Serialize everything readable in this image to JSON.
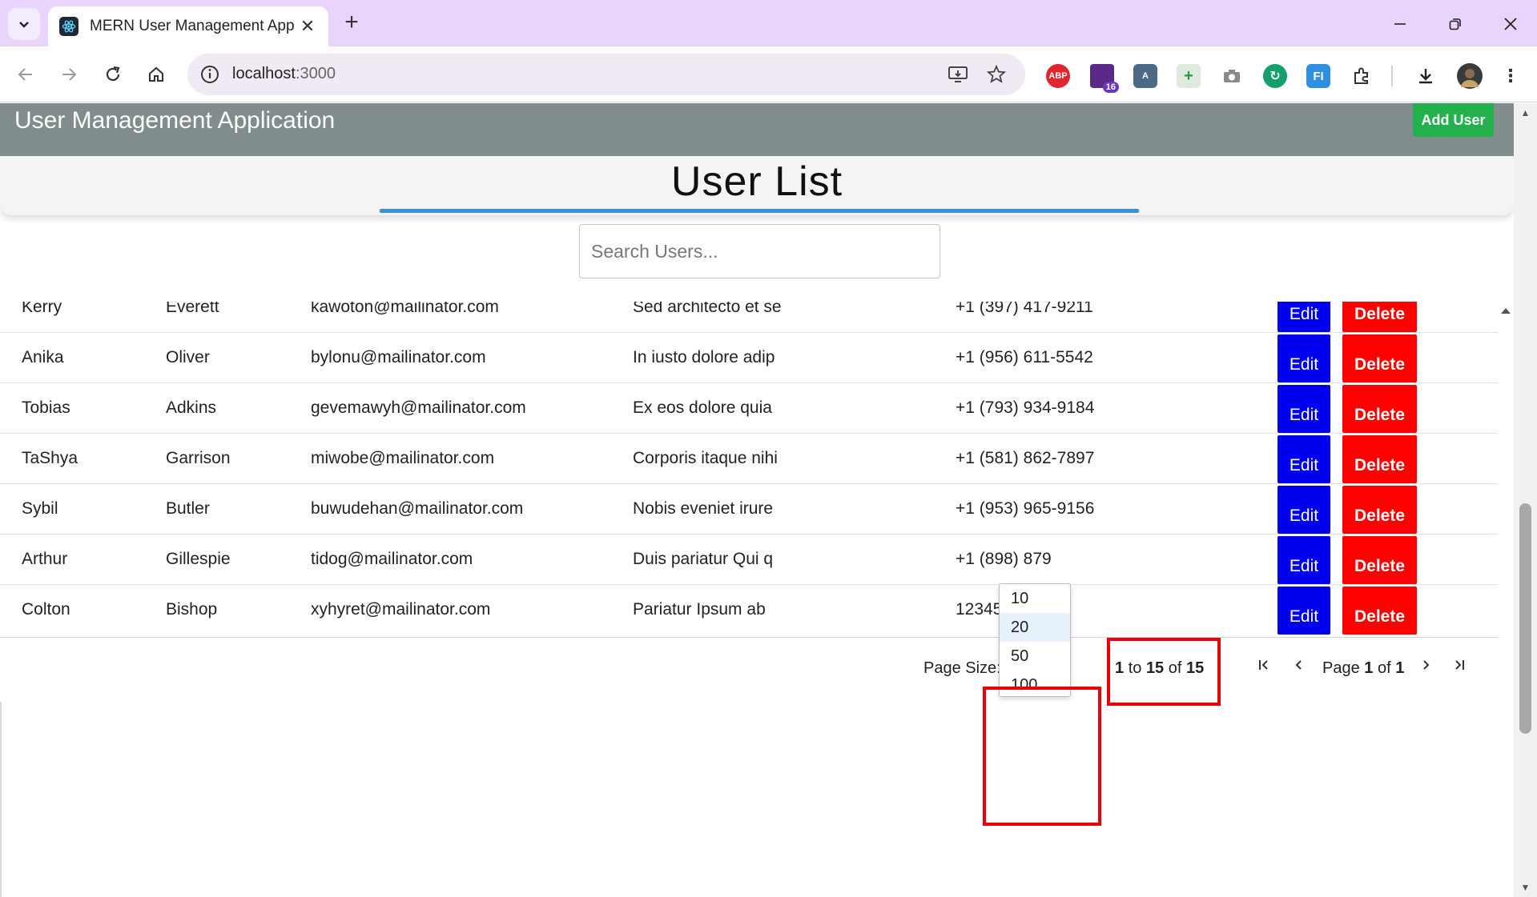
{
  "browser": {
    "tab_title": "MERN User Management App",
    "url_host": "localhost",
    "url_port": ":3000",
    "extensions": [
      "ABP",
      "16"
    ]
  },
  "app": {
    "title": "User Management Application",
    "add_user_label": "Add User",
    "heading": "User List",
    "search_placeholder": "Search Users..."
  },
  "table": {
    "edit_label": "Edit",
    "delete_label": "Delete",
    "rows": [
      {
        "first": "Kerry",
        "last": "Everett",
        "email": "kawoton@mailinator.com",
        "address": "Sed architecto et se",
        "phone": "+1 (397) 417-9211"
      },
      {
        "first": "Anika",
        "last": "Oliver",
        "email": "bylonu@mailinator.com",
        "address": "In iusto dolore adip",
        "phone": "+1 (956) 611-5542"
      },
      {
        "first": "Tobias",
        "last": "Adkins",
        "email": "gevemawyh@mailinator.com",
        "address": "Ex eos dolore quia",
        "phone": "+1 (793) 934-9184"
      },
      {
        "first": "TaShya",
        "last": "Garrison",
        "email": "miwobe@mailinator.com",
        "address": "Corporis itaque nihi",
        "phone": "+1 (581) 862-7897"
      },
      {
        "first": "Sybil",
        "last": "Butler",
        "email": "buwudehan@mailinator.com",
        "address": "Nobis eveniet irure",
        "phone": "+1 (953) 965-9156"
      },
      {
        "first": "Arthur",
        "last": "Gillespie",
        "email": "tidog@mailinator.com",
        "address": "Duis pariatur Qui q",
        "phone": "+1 (898) 879"
      },
      {
        "first": "Colton",
        "last": "Bishop",
        "email": "xyhyret@mailinator.com",
        "address": "Pariatur Ipsum ab",
        "phone": "12345678"
      }
    ]
  },
  "pager": {
    "page_size_label": "Page Size:",
    "page_size_value": "20",
    "page_size_options": [
      "10",
      "20",
      "50",
      "100"
    ],
    "summary_from": "1",
    "summary_to_word": "to",
    "summary_to": "15",
    "summary_of_word": "of",
    "summary_total": "15",
    "page_word": "Page",
    "page_current": "1",
    "page_of_word": "of",
    "page_total": "1"
  },
  "colors": {
    "appbar": "#808d8c",
    "add_button": "#22b14c",
    "edit_button": "#0000ee",
    "delete_button": "#ff0000",
    "heading_underline": "#3a8ee0",
    "highlight_box": "#e8000b"
  }
}
